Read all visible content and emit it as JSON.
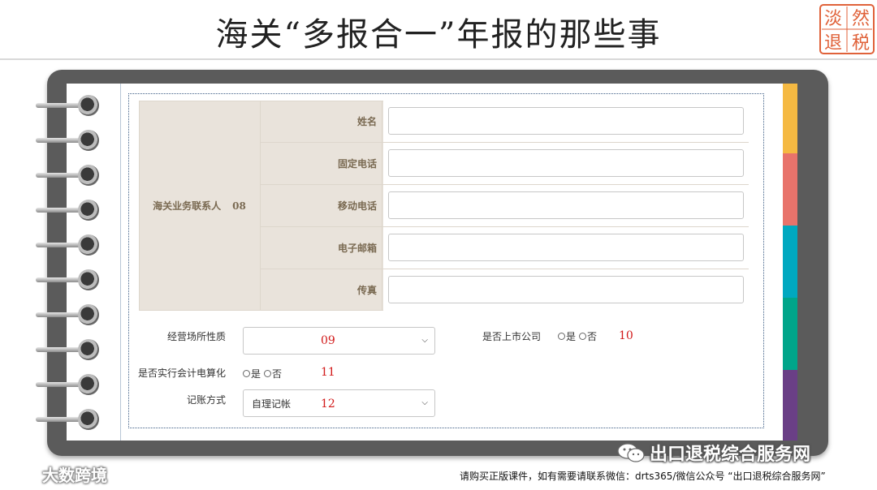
{
  "title": "海关“多报合一”年报的那些事",
  "seal": {
    "chars": [
      "淡",
      "然",
      "退",
      "税"
    ],
    "color": "#e0623a"
  },
  "contact_group": {
    "label": "海关业务联系人",
    "number": "08",
    "fields": [
      {
        "label": "姓名",
        "value": ""
      },
      {
        "label": "固定电话",
        "value": ""
      },
      {
        "label": "移动电话",
        "value": ""
      },
      {
        "label": "电子邮箱",
        "value": ""
      },
      {
        "label": "传真",
        "value": ""
      }
    ]
  },
  "business_premises": {
    "label": "经营场所性质",
    "value": "",
    "number": "09"
  },
  "listed_company": {
    "label": "是否上市公司",
    "options": [
      "是",
      "否"
    ],
    "number": "10"
  },
  "accounting_computerized": {
    "label": "是否实行会计电算化",
    "options": [
      "是",
      "否"
    ],
    "number": "11"
  },
  "bookkeeping": {
    "label": "记账方式",
    "value": "自理记帐",
    "number": "12"
  },
  "tab_colors": [
    "#f5b942",
    "#e8736b",
    "#00a8c0",
    "#00a58a",
    "#6a3f86"
  ],
  "wechat": {
    "icon": "wechat-icon",
    "text": "出口退税综合服务网"
  },
  "brand": {
    "icon": "brand-logo-icon",
    "text": "大数跨境"
  },
  "footnote": "请购买正版课件，如有需要请联系微信：drts365/微信公众号 “出口退税综合服务网”"
}
